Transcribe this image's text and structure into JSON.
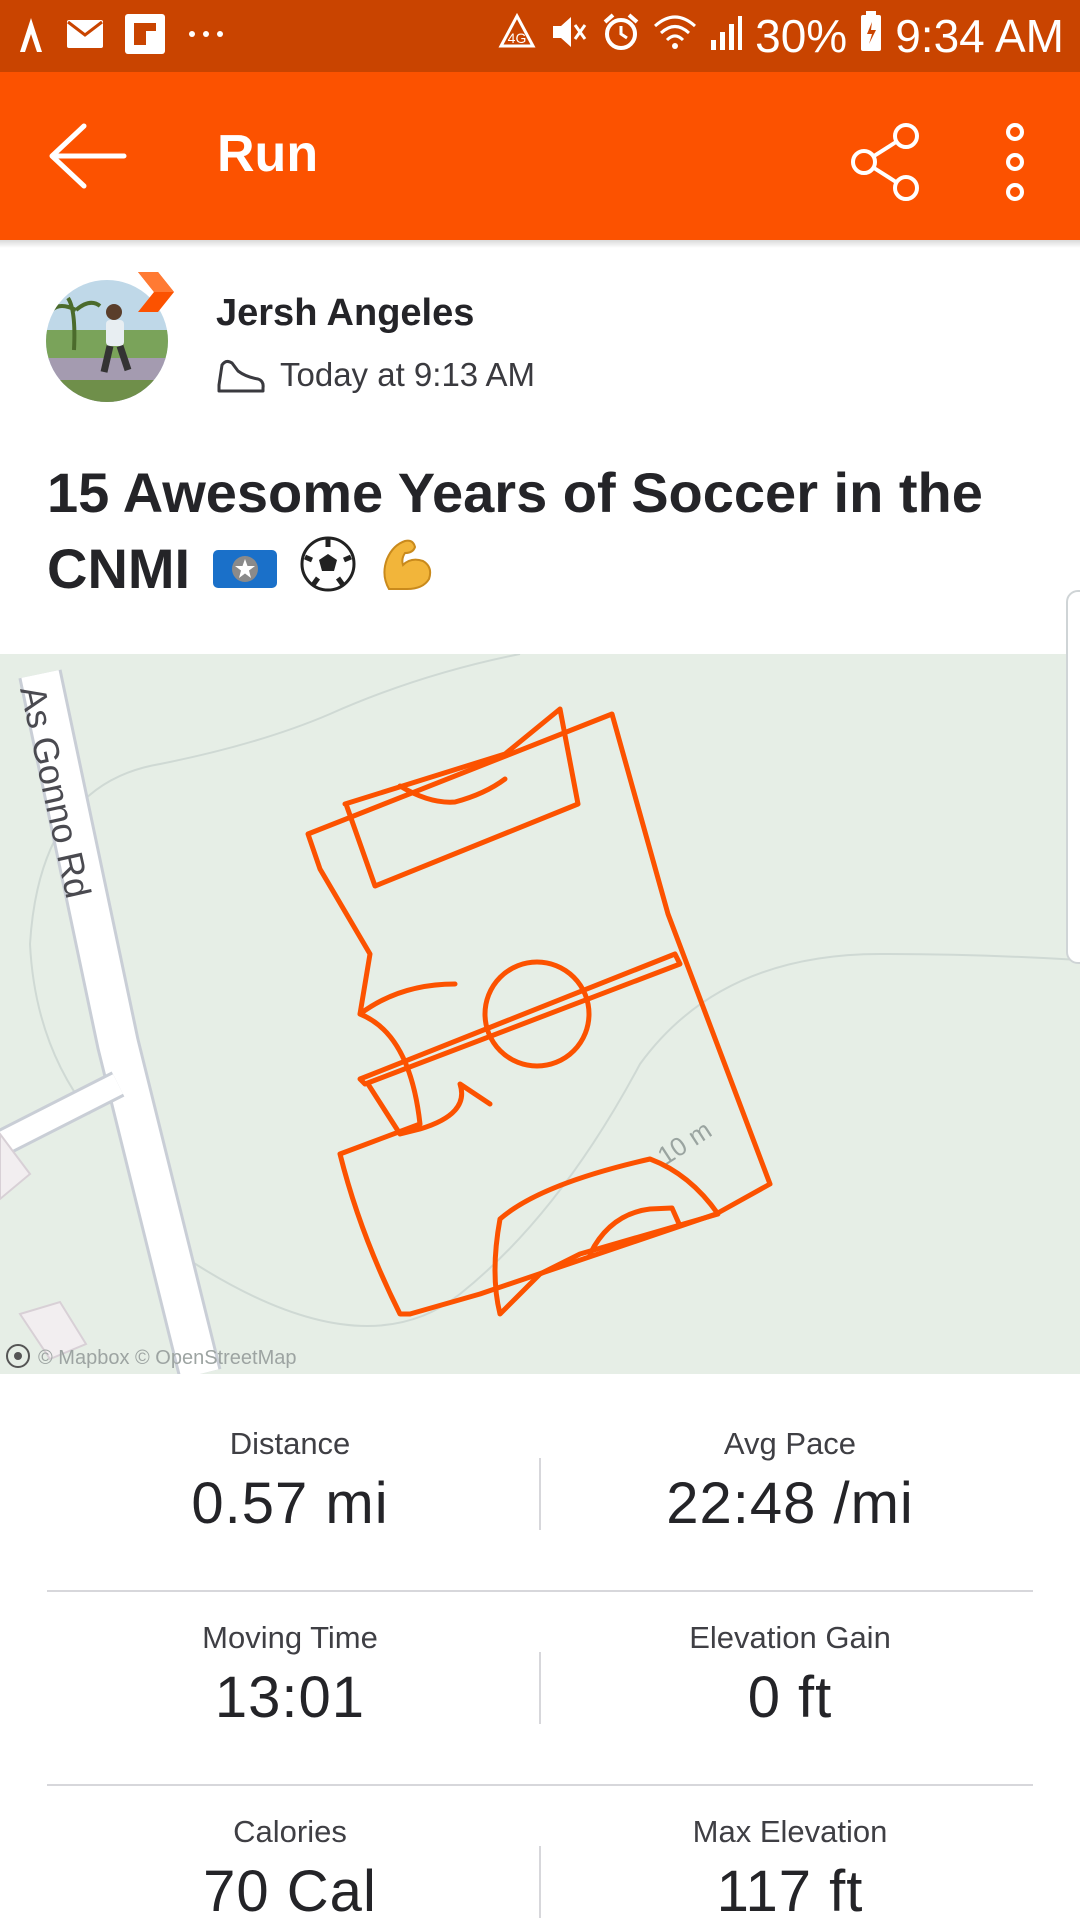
{
  "status_bar": {
    "battery": "30%",
    "time": "9:34 AM",
    "notification_icons": [
      "strava-icon",
      "mail-icon",
      "flipboard-icon",
      "more-notifications-icon"
    ],
    "system_icons": [
      "data-saver-icon",
      "mute-icon",
      "alarm-icon",
      "wifi-icon",
      "signal-icon",
      "battery-icon"
    ]
  },
  "app_bar": {
    "title": "Run",
    "back_icon": "arrow-left-icon",
    "share_icon": "share-icon",
    "more_icon": "more-vert-icon"
  },
  "activity": {
    "athlete_name": "Jersh Angeles",
    "timestamp": "Today at 9:13 AM",
    "type_icon": "shoe-icon",
    "title": "15 Awesome Years of Soccer in the CNMI",
    "title_emojis": [
      "cnmi-flag-icon",
      "soccer-ball-icon",
      "flexed-biceps-icon"
    ]
  },
  "map": {
    "road_label": "As Gonno Rd",
    "contour_label": "10 m",
    "attribution": "© Mapbox © OpenStreetMap",
    "route_color": "#fc5200"
  },
  "stats": [
    {
      "label": "Distance",
      "value": "0.57 mi"
    },
    {
      "label": "Avg Pace",
      "value": "22:48 /mi"
    },
    {
      "label": "Moving Time",
      "value": "13:01"
    },
    {
      "label": "Elevation Gain",
      "value": "0 ft"
    },
    {
      "label": "Calories",
      "value": "70 Cal"
    },
    {
      "label": "Max Elevation",
      "value": "117 ft"
    }
  ],
  "colors": {
    "brand": "#fc5200",
    "status_bar": "#c94400",
    "map_background": "#e6eee6"
  }
}
